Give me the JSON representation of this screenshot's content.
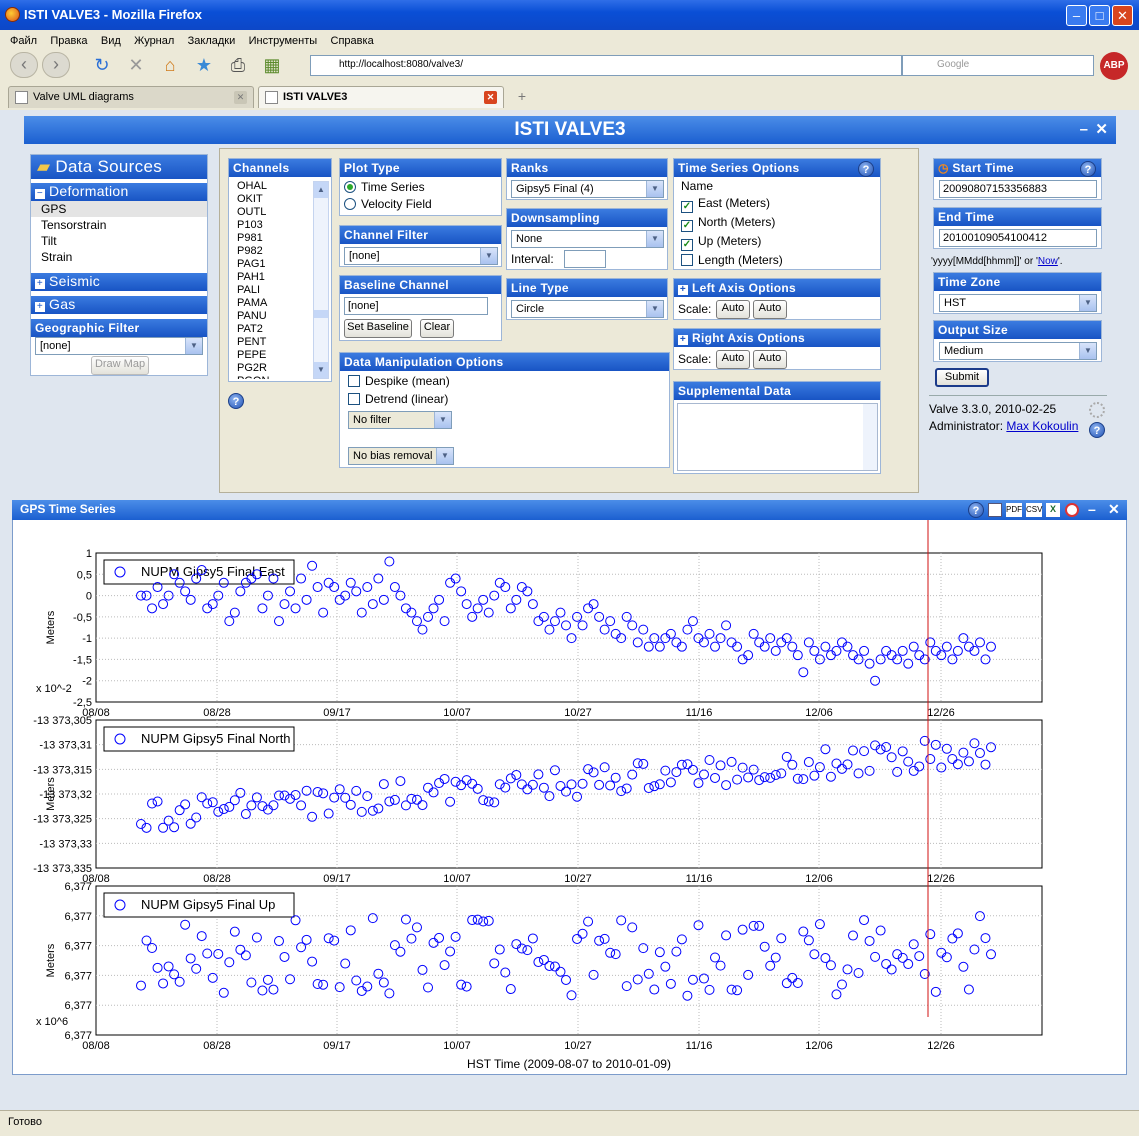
{
  "window": {
    "title": "ISTI VALVE3 - Mozilla Firefox"
  },
  "menubar": [
    "Файл",
    "Правка",
    "Вид",
    "Журнал",
    "Закладки",
    "Инструменты",
    "Справка"
  ],
  "url": "http://localhost:8080/valve3/",
  "search_placeholder": "Google",
  "abp_label": "ABP",
  "tabs": [
    {
      "label": "Valve UML diagrams"
    },
    {
      "label": "ISTI VALVE3"
    }
  ],
  "app": {
    "title": "ISTI VALVE3"
  },
  "data_sources": {
    "header": "Data Sources",
    "deformation": {
      "label": "Deformation",
      "items": [
        "GPS",
        "Tensorstrain",
        "Tilt",
        "Strain"
      ],
      "selected": "GPS"
    },
    "seismic": "Seismic",
    "gas": "Gas",
    "geo_filter": {
      "header": "Geographic Filter",
      "value": "[none]",
      "draw_map": "Draw Map"
    }
  },
  "channels": {
    "header": "Channels",
    "items": [
      "OHAL",
      "OKIT",
      "OUTL",
      "P103",
      "P981",
      "P982",
      "PAG1",
      "PAH1",
      "PALI",
      "PAMA",
      "PANU",
      "PAT2",
      "PENT",
      "PEPE",
      "PG2R",
      "PGON"
    ]
  },
  "plot_type": {
    "header": "Plot Type",
    "options": [
      "Time Series",
      "Velocity Field"
    ],
    "selected": "Time Series"
  },
  "channel_filter": {
    "header": "Channel Filter",
    "value": "[none]"
  },
  "baseline": {
    "header": "Baseline Channel",
    "value": "[none]",
    "set": "Set Baseline",
    "clear": "Clear"
  },
  "data_manip": {
    "header": "Data Manipulation Options",
    "despike": "Despike (mean)",
    "detrend": "Detrend (linear)",
    "filter": "No filter",
    "bias": "No bias removal"
  },
  "ranks": {
    "header": "Ranks",
    "value": "Gipsy5 Final (4)"
  },
  "downsampling": {
    "header": "Downsampling",
    "value": "None",
    "interval_label": "Interval:",
    "interval": ""
  },
  "line_type": {
    "header": "Line Type",
    "value": "Circle"
  },
  "ts_options": {
    "header": "Time Series Options",
    "name_label": "Name",
    "items": [
      {
        "label": "East (Meters)",
        "checked": true
      },
      {
        "label": "North (Meters)",
        "checked": true
      },
      {
        "label": "Up (Meters)",
        "checked": true
      },
      {
        "label": "Length (Meters)",
        "checked": false
      }
    ]
  },
  "left_axis": {
    "header": "Left Axis Options",
    "scale": "Scale:",
    "a": "Auto",
    "b": "Auto"
  },
  "right_axis": {
    "header": "Right Axis Options",
    "scale": "Scale:",
    "a": "Auto",
    "b": "Auto"
  },
  "supplemental": {
    "header": "Supplemental Data"
  },
  "start_time": {
    "header": "Start Time",
    "value": "20090807153356883"
  },
  "end_time": {
    "header": "End Time",
    "value": "20100109054100412"
  },
  "time_hint": {
    "format": "'yyyy[MMdd[hhmm]]' or '",
    "now": "Now",
    "end": "'."
  },
  "time_zone": {
    "header": "Time Zone",
    "value": "HST"
  },
  "output_size": {
    "header": "Output Size",
    "value": "Medium"
  },
  "submit": "Submit",
  "version": "Valve 3.3.0, 2010-02-25",
  "admin": {
    "label": "Administrator: ",
    "name": "Max Kokoulin"
  },
  "plot_window": {
    "title": "GPS Time Series",
    "icons": [
      "?",
      "PDF",
      "CSV",
      "X"
    ]
  },
  "status": {
    "text": "Готово"
  },
  "chart_data": [
    {
      "type": "scatter",
      "legend": "NUPM Gipsy5 Final East",
      "ylabel": "Meters",
      "multiplier": "x 10^-2",
      "yticks": [
        "1",
        "0,5",
        "0",
        "-0,5",
        "-1",
        "-1,5",
        "-2",
        "-2,5"
      ],
      "ylim": [
        -2.5,
        1
      ],
      "xticks": [
        "08/08",
        "08/28",
        "09/17",
        "10/07",
        "10/27",
        "11/16",
        "12/06",
        "12/26"
      ],
      "x": [
        0,
        1,
        2,
        3,
        4,
        5,
        6,
        7,
        8,
        9,
        10,
        11,
        12,
        13,
        14,
        15,
        16,
        17,
        18,
        19,
        20,
        21,
        22,
        23,
        24,
        25,
        26,
        27,
        28,
        29,
        30,
        31,
        32,
        33,
        34,
        35,
        36,
        37,
        38,
        39,
        40,
        41,
        42,
        43,
        44,
        45,
        46,
        47,
        48,
        49,
        50,
        51,
        52,
        53,
        54,
        55,
        56,
        57,
        58,
        59,
        60,
        61,
        62,
        63,
        64,
        65,
        66,
        67,
        68,
        69,
        70,
        71,
        72,
        73,
        74,
        75,
        76,
        77,
        78,
        79,
        80,
        81,
        82,
        83,
        84,
        85,
        86,
        87,
        88,
        89,
        90,
        91,
        92,
        93,
        94,
        95,
        96,
        97,
        98,
        99,
        100,
        101,
        102,
        103,
        104,
        105,
        106,
        107,
        108,
        109,
        110,
        111,
        112,
        113,
        114,
        115,
        116,
        117,
        118,
        119,
        120,
        121,
        122,
        123,
        124,
        125,
        126,
        127,
        128,
        129,
        130,
        131,
        132,
        133,
        134,
        135,
        136,
        137,
        138,
        139,
        140,
        141,
        142,
        143,
        144,
        145,
        146,
        147,
        148,
        149,
        150,
        151,
        152,
        153,
        154
      ],
      "values": [
        0,
        0,
        -0.3,
        0.2,
        -0.2,
        0,
        0.5,
        0.3,
        0.1,
        -0.1,
        0.4,
        0.6,
        -0.3,
        -0.2,
        0,
        0.3,
        -0.6,
        -0.4,
        0.1,
        0.3,
        0.4,
        0.5,
        -0.3,
        0,
        0.4,
        -0.6,
        -0.2,
        0.1,
        -0.3,
        0.4,
        -0.1,
        0.7,
        0.2,
        -0.4,
        0.3,
        0.2,
        -0.1,
        0,
        0.3,
        0.1,
        -0.4,
        0.2,
        -0.2,
        0.4,
        -0.1,
        0.8,
        0.2,
        0,
        -0.3,
        -0.4,
        -0.6,
        -0.8,
        -0.5,
        -0.3,
        -0.1,
        -0.6,
        0.3,
        0.4,
        0.1,
        -0.2,
        -0.5,
        -0.3,
        -0.1,
        -0.4,
        0,
        0.3,
        0.2,
        -0.3,
        -0.1,
        0.2,
        0.1,
        -0.2,
        -0.6,
        -0.5,
        -0.8,
        -0.6,
        -0.4,
        -0.7,
        -1,
        -0.5,
        -0.7,
        -0.3,
        -0.2,
        -0.5,
        -0.8,
        -0.6,
        -0.9,
        -1,
        -0.5,
        -0.7,
        -1.1,
        -0.8,
        -1.2,
        -1,
        -1.2,
        -1,
        -0.9,
        -1.1,
        -1.2,
        -0.8,
        -0.6,
        -1,
        -1.1,
        -0.9,
        -1.2,
        -1,
        -0.7,
        -1.1,
        -1.2,
        -1.5,
        -1.4,
        -0.9,
        -1.1,
        -1.2,
        -1,
        -1.3,
        -1.1,
        -1,
        -1.2,
        -1.4,
        -1.8,
        -1.1,
        -1.3,
        -1.5,
        -1.2,
        -1.4,
        -1.3,
        -1.1,
        -1.2,
        -1.4,
        -1.5,
        -1.3,
        -1.6,
        -2,
        -1.5,
        -1.3,
        -1.4,
        -1.5,
        -1.3,
        -1.6,
        -1.2,
        -1.4,
        -1.5,
        -1.1,
        -1.3,
        -1.4,
        -1.2,
        -1.5,
        -1.3,
        -1,
        -1.2,
        -1.3,
        -1.1,
        -1.5,
        -1.2
      ]
    },
    {
      "type": "scatter",
      "legend": "NUPM Gipsy5 Final North",
      "ylabel": "Meters",
      "yticks": [
        "-13 373,305",
        "-13 373,31",
        "-13 373,315",
        "-13 373,32",
        "-13 373,325",
        "-13 373,33",
        "-13 373,335"
      ],
      "ylim": [
        -13373.335,
        -13373.305
      ],
      "xticks": [
        "08/08",
        "08/28",
        "09/17",
        "10/07",
        "10/27",
        "11/16",
        "12/06",
        "12/26"
      ]
    },
    {
      "type": "scatter",
      "legend": "NUPM Gipsy5 Final Up",
      "ylabel": "Meters",
      "multiplier": "x 10^6",
      "yticks": [
        "6,377",
        "6,377",
        "6,377",
        "6,377",
        "6,377",
        "6,377"
      ],
      "xticks": [
        "08/08",
        "08/28",
        "09/17",
        "10/07",
        "10/27",
        "11/16",
        "12/06",
        "12/26"
      ],
      "xlabel": "HST Time (2009-08-07 to 2010-01-09)"
    }
  ]
}
